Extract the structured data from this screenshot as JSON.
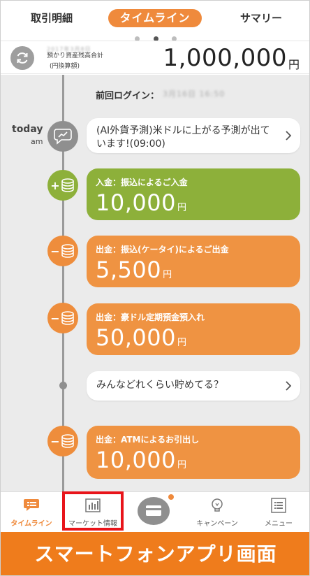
{
  "tabs": [
    {
      "label": "取引明細"
    },
    {
      "label": "タイムライン"
    },
    {
      "label": "サマリー"
    }
  ],
  "asset": {
    "date": "2017年3月8日",
    "label": "預かり資産残高合計",
    "sub": "(円換算額)",
    "amount": "1,000,000",
    "unit": "円"
  },
  "timeline": {
    "last_login_label": "前回ログイン：",
    "last_login_value": "3月16日 16:50",
    "today": "today",
    "am": "am",
    "items": [
      {
        "kind": "notice",
        "text": "(AI外貨予測)米ドルに上がる予測が出ています!(09:00)"
      },
      {
        "kind": "deposit",
        "sign": "+",
        "title": "入金：振込によるご入金",
        "amount": "10,000",
        "unit": "円"
      },
      {
        "kind": "withdrawal",
        "sign": "−",
        "title": "出金：振込(ケータイ)によるご出金",
        "amount": "5,500",
        "unit": "円"
      },
      {
        "kind": "withdrawal",
        "sign": "−",
        "title": "出金：豪ドル定期預金預入れ",
        "amount": "50,000",
        "unit": "円"
      },
      {
        "kind": "notice",
        "text": "みんなどれくらい貯めてる？"
      },
      {
        "kind": "withdrawal",
        "sign": "−",
        "title": "出金：ATMによるお引出し",
        "amount": "10,000",
        "unit": "円"
      }
    ]
  },
  "nav": [
    {
      "label": "タイムライン",
      "icon": "chat-list-icon"
    },
    {
      "label": "マーケット情報",
      "icon": "bar-chart-icon"
    },
    {
      "label": "",
      "icon": "card-icon"
    },
    {
      "label": "キャンペーン",
      "icon": "lightbulb-icon"
    },
    {
      "label": "メニュー",
      "icon": "menu-list-icon"
    }
  ],
  "banner": {
    "text": "スマートフォンアプリ画面"
  },
  "colors": {
    "accent": "#ef8a3c",
    "deposit": "#8db03a",
    "withdrawal": "#ef9342",
    "banner": "#ef7c1c",
    "highlight": "#e8141a"
  }
}
